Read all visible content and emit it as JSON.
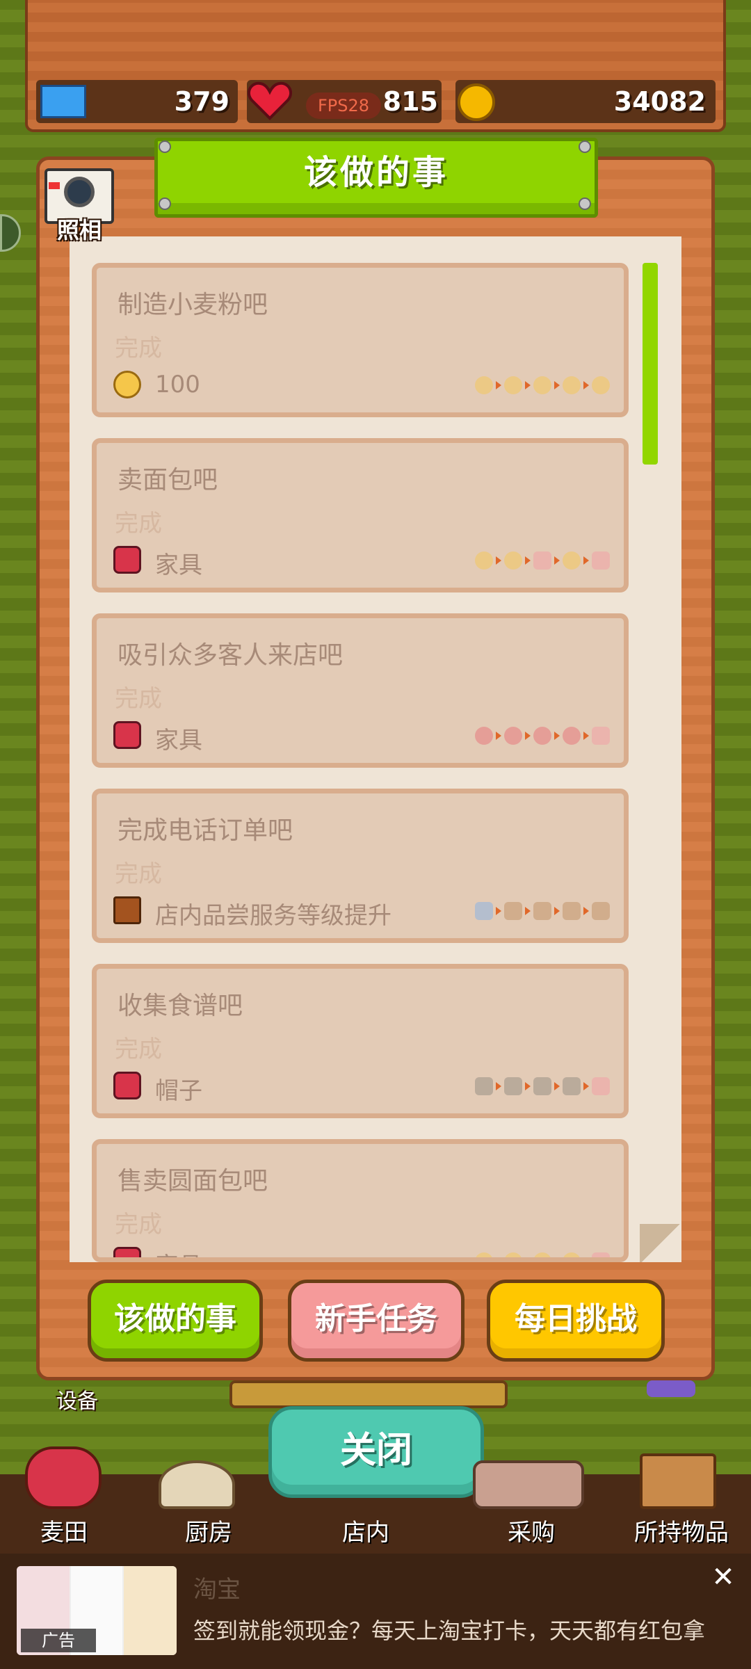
{
  "resources": {
    "tickets": "379",
    "hearts": "815",
    "fps": "FPS28",
    "coins": "34082"
  },
  "panel": {
    "title": "该做的事",
    "camera_label": "照相"
  },
  "tasks": [
    {
      "title": "制造小麦粉吧",
      "status": "完成",
      "reward_icon": "coin-icon",
      "reward": "100",
      "steps": [
        "coin",
        "coin",
        "coin",
        "coin",
        "coin"
      ]
    },
    {
      "title": "卖面包吧",
      "status": "完成",
      "reward_icon": "gift-icon",
      "reward": "家具",
      "steps": [
        "coin",
        "coin",
        "gift",
        "coin",
        "gift"
      ]
    },
    {
      "title": "吸引众多客人来店吧",
      "status": "完成",
      "reward_icon": "gift-icon",
      "reward": "家具",
      "steps": [
        "heart",
        "heart",
        "heart",
        "heart",
        "gift"
      ]
    },
    {
      "title": "完成电话订单吧",
      "status": "完成",
      "reward_icon": "chair-icon",
      "reward": "店内品尝服务等级提升",
      "steps": [
        "ticket",
        "chair",
        "chair",
        "chair",
        "chair"
      ]
    },
    {
      "title": "收集食谱吧",
      "status": "完成",
      "reward_icon": "gift-icon",
      "reward": "帽子",
      "steps": [
        "book",
        "book",
        "book",
        "book",
        "gift"
      ]
    },
    {
      "title": "售卖圆面包吧",
      "status": "完成",
      "reward_icon": "gift-icon",
      "reward": "家具",
      "steps": [
        "coin",
        "coin",
        "coin",
        "coin",
        "gift"
      ]
    }
  ],
  "tabs": {
    "todo": "该做的事",
    "newbie": "新手任务",
    "daily": "每日挑战"
  },
  "close_label": "关闭",
  "equipment_label": "设备",
  "nav": [
    "麦田",
    "厨房",
    "店内",
    "采购",
    "所持物品"
  ],
  "ad": {
    "label": "广告",
    "brand": "淘宝",
    "text": "签到就能领现金？每天上淘宝打卡，天天都有红包拿",
    "close": "✕"
  },
  "colors": {
    "accent_green": "#8fd400",
    "tab_pink": "#f59a9a",
    "tab_yellow": "#ffc700",
    "close_teal": "#4fc9b0"
  }
}
